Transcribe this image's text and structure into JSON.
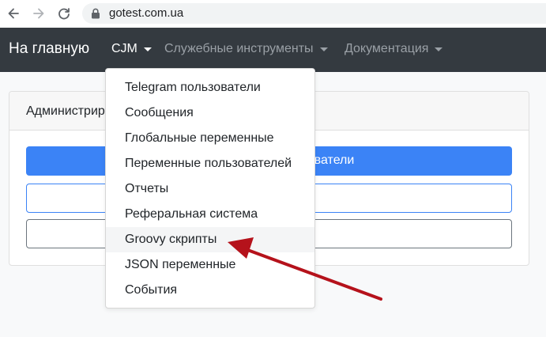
{
  "browser": {
    "url": "gotest.com.ua",
    "icons": [
      "back-arrow-icon",
      "forward-arrow-icon",
      "reload-icon",
      "lock-icon"
    ]
  },
  "navbar": {
    "brand": "На главную",
    "items": [
      {
        "label": "CJM",
        "active": true
      },
      {
        "label": "Служебные инструменты",
        "active": false
      },
      {
        "label": "Документация",
        "active": false
      }
    ]
  },
  "card": {
    "title": "Администрир",
    "primary_button_visible": "ватели"
  },
  "dropdown": {
    "items": [
      "Telegram пользователи",
      "Сообщения",
      "Глобальные переменные",
      "Переменные пользователей",
      "Отчеты",
      "Реферальная система",
      "Groovy скрипты",
      "JSON переменные",
      "События"
    ],
    "highlighted_index": 6
  },
  "colors": {
    "navbar_bg": "#343a40",
    "primary": "#3b83f6",
    "annotation_arrow": "#b5121b"
  }
}
